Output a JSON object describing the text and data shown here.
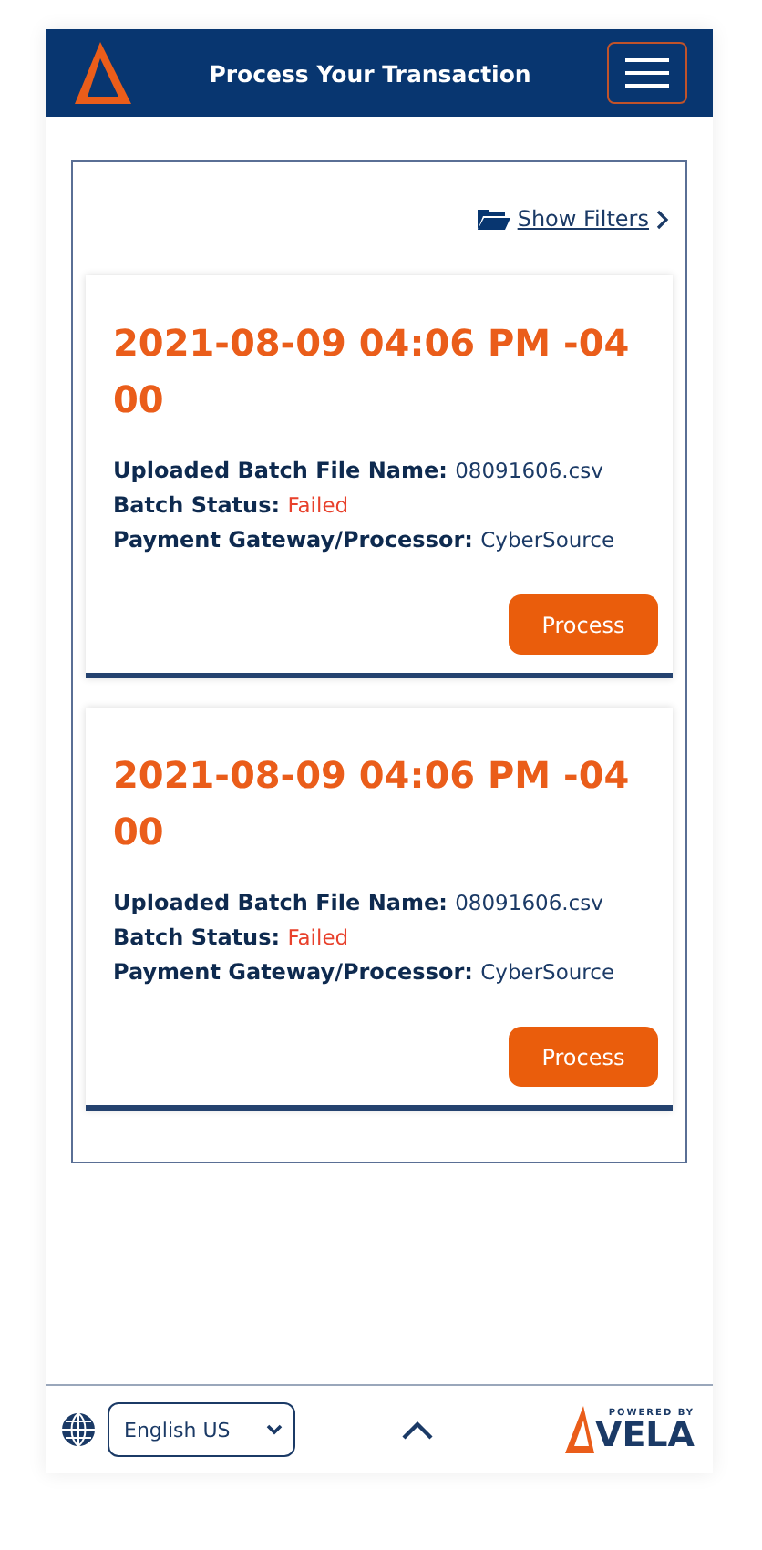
{
  "header": {
    "title": "Process Your Transaction"
  },
  "filters": {
    "label": "Show Filters"
  },
  "batches": [
    {
      "timestamp": "2021-08-09 04:06 PM -0400",
      "fields": [
        {
          "label": "Uploaded Batch File Name:",
          "value": "08091606.csv",
          "kind": "plain"
        },
        {
          "label": "Batch Status:",
          "value": "Failed",
          "kind": "error"
        },
        {
          "label": "Payment Gateway/Processor:",
          "value": "CyberSource",
          "kind": "plain"
        }
      ],
      "action": "Process"
    },
    {
      "timestamp": "2021-08-09 04:06 PM -0400",
      "fields": [
        {
          "label": "Uploaded Batch File Name:",
          "value": "08091606.csv",
          "kind": "plain"
        },
        {
          "label": "Batch Status:",
          "value": "Failed",
          "kind": "error"
        },
        {
          "label": "Payment Gateway/Processor:",
          "value": "CyberSource",
          "kind": "plain"
        }
      ],
      "action": "Process"
    }
  ],
  "footer": {
    "language": "English US",
    "powered_by": "POWERED BY",
    "brand": "VELA"
  }
}
